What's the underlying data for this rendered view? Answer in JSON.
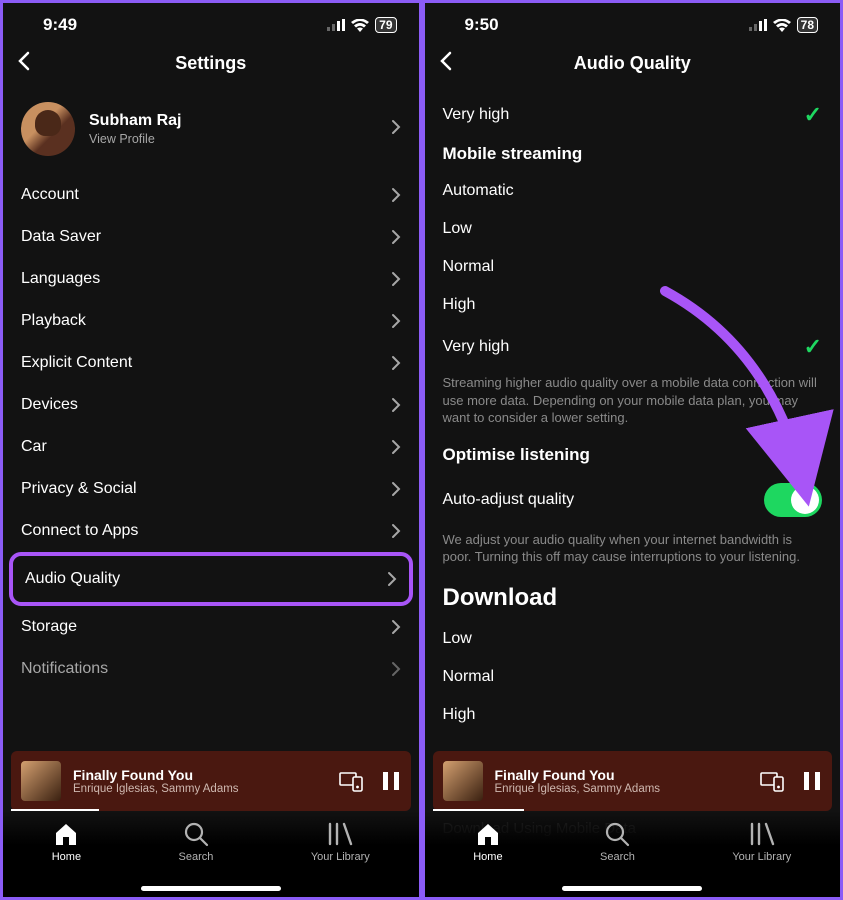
{
  "left": {
    "status": {
      "time": "9:49",
      "battery": "79"
    },
    "header": {
      "title": "Settings"
    },
    "profile": {
      "name": "Subham Raj",
      "sub": "View Profile"
    },
    "items": [
      {
        "label": "Account"
      },
      {
        "label": "Data Saver"
      },
      {
        "label": "Languages"
      },
      {
        "label": "Playback"
      },
      {
        "label": "Explicit Content"
      },
      {
        "label": "Devices"
      },
      {
        "label": "Car"
      },
      {
        "label": "Privacy & Social"
      },
      {
        "label": "Connect to Apps"
      },
      {
        "label": "Audio Quality"
      },
      {
        "label": "Storage"
      },
      {
        "label": "Notifications"
      }
    ],
    "np": {
      "title": "Finally Found You",
      "artist": "Enrique Iglesias, Sammy Adams"
    },
    "nav": {
      "home": "Home",
      "search": "Search",
      "library": "Your Library"
    }
  },
  "right": {
    "status": {
      "time": "9:50",
      "battery": "78"
    },
    "header": {
      "title": "Audio Quality"
    },
    "top_option": "Very high",
    "section_mobile": "Mobile streaming",
    "mobile_options": [
      "Automatic",
      "Low",
      "Normal",
      "High",
      "Very high"
    ],
    "mobile_desc": "Streaming higher audio quality over a mobile data connection will use more data. Depending on your mobile data plan, you may want to consider a lower setting.",
    "section_optimise": "Optimise listening",
    "auto_adjust": {
      "label": "Auto-adjust quality"
    },
    "auto_desc": "We adjust your audio quality when your internet bandwidth is poor. Turning this off may cause interruptions to your listening.",
    "section_download": "Download",
    "download_options": [
      "Low",
      "Normal",
      "High"
    ],
    "obscured": "Download Using Mobile Data",
    "np": {
      "title": "Finally Found You",
      "artist": "Enrique Iglesias, Sammy Adams"
    },
    "nav": {
      "home": "Home",
      "search": "Search",
      "library": "Your Library"
    }
  }
}
